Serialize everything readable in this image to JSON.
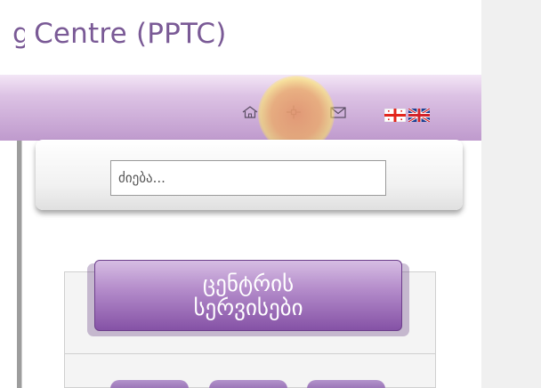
{
  "header": {
    "title_visible": "Centre (PPTC)",
    "title_partial_glyph": "g"
  },
  "nav": {
    "icons": [
      {
        "name": "home-icon"
      },
      {
        "name": "sitemap-icon"
      },
      {
        "name": "mail-icon"
      }
    ],
    "languages": [
      {
        "name": "georgian-flag-icon"
      },
      {
        "name": "english-flag-icon"
      }
    ]
  },
  "search": {
    "placeholder": "ძიება..."
  },
  "services": {
    "line1": "ცენტრის",
    "line2": "სერვისები"
  },
  "colors": {
    "title": "#7a5a96",
    "nav_top": "#f3e6f6",
    "nav_bottom": "#bf9acd",
    "ribbon": "#8552a6",
    "right_strip": "#f0f0f0"
  }
}
